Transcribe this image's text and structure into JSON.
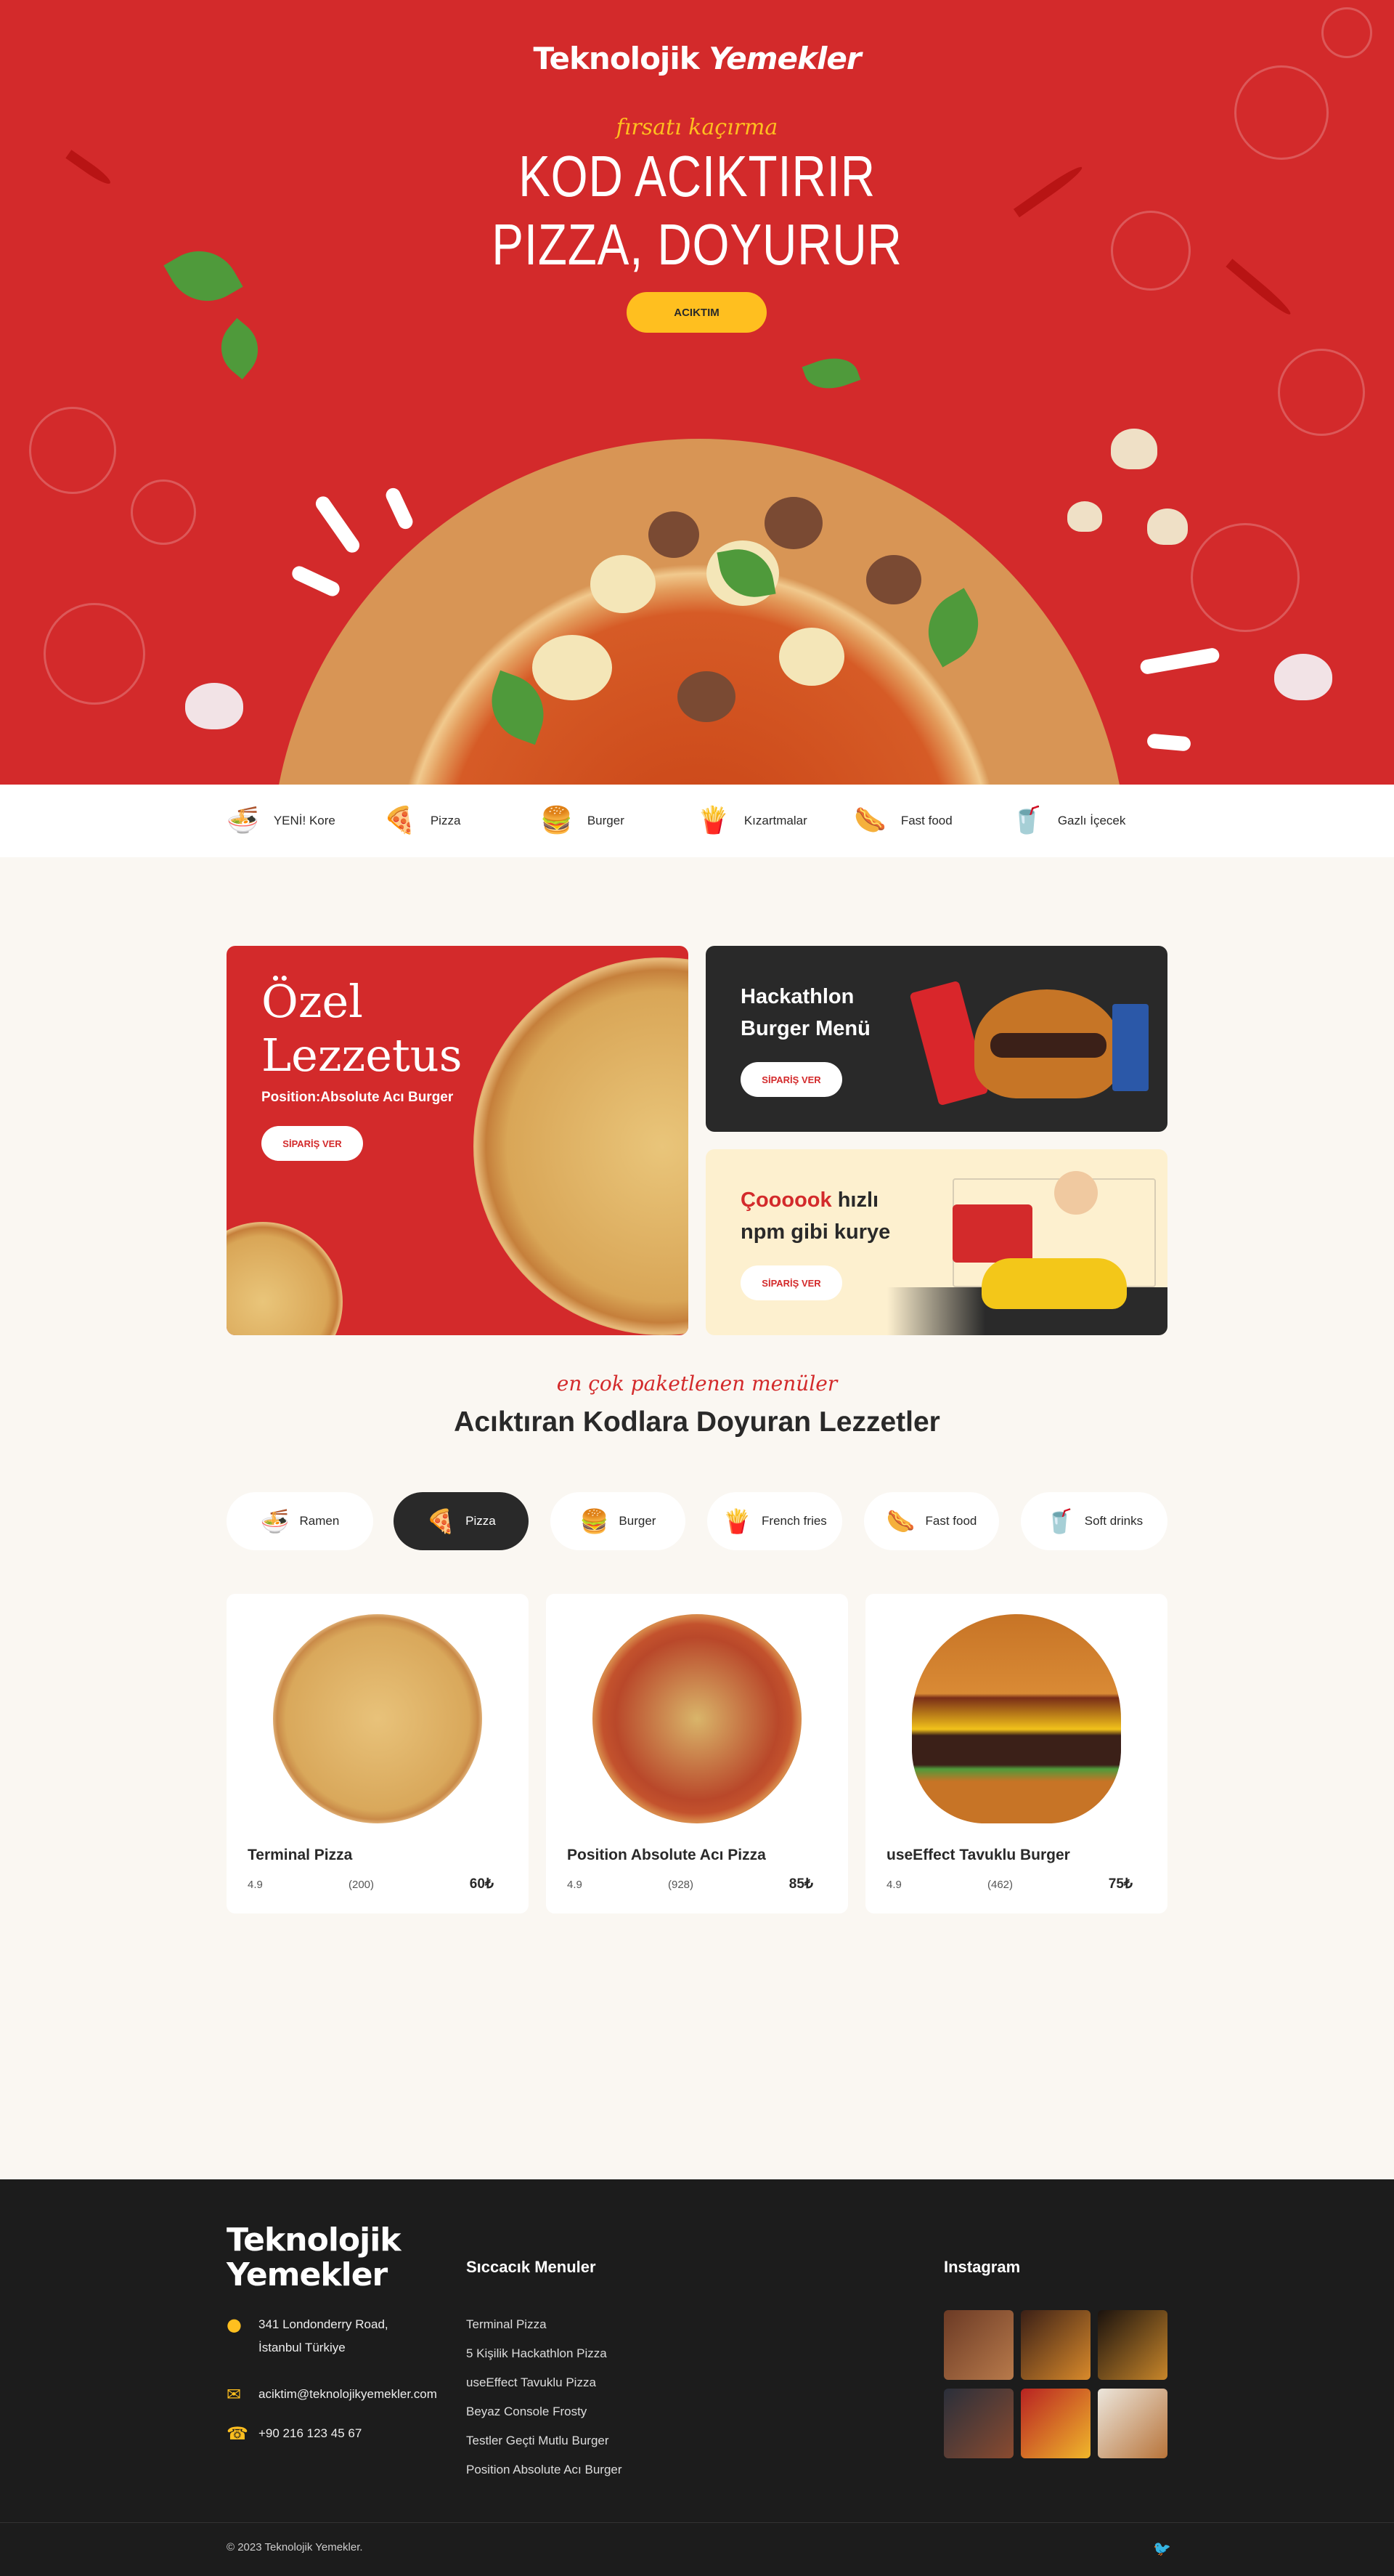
{
  "brand": {
    "part1": "Teknolojik",
    "part2": "Yemekler"
  },
  "hero": {
    "script": "fırsatı kaçırma",
    "title_line1": "KOD ACIKTIRIR",
    "title_line2": "PIZZA, DOYURUR",
    "cta": "ACIKTIM"
  },
  "categories": [
    {
      "label": "YENİ! Kore",
      "icon": "ramen-icon",
      "glyph": "🍜"
    },
    {
      "label": "Pizza",
      "icon": "pizza-icon",
      "glyph": "🍕"
    },
    {
      "label": "Burger",
      "icon": "burger-icon",
      "glyph": "🍔"
    },
    {
      "label": "Kızartmalar",
      "icon": "fries-icon",
      "glyph": "🍟"
    },
    {
      "label": "Fast food",
      "icon": "fastfood-icon",
      "glyph": "🌭"
    },
    {
      "label": "Gazlı İçecek",
      "icon": "drink-icon",
      "glyph": "🥤"
    }
  ],
  "promos": {
    "big": {
      "title_line1": "Özel",
      "title_line2": "Lezzetus",
      "subtitle": "Position:Absolute Acı Burger",
      "cta": "SİPARİŞ VER"
    },
    "dark": {
      "title_line1": "Hackathlon",
      "title_line2": "Burger Menü",
      "cta": "SİPARİŞ VER"
    },
    "cream": {
      "accent": "Çoooook",
      "title_rest": " hızlı",
      "title_line2": "npm gibi kurye",
      "cta": "SİPARİŞ VER"
    }
  },
  "menu": {
    "script": "en çok paketlenen menüler",
    "title": "Acıktıran Kodlara Doyuran Lezzetler",
    "tabs": [
      {
        "label": "Ramen",
        "icon": "ramen-icon",
        "glyph": "🍜",
        "active": false
      },
      {
        "label": "Pizza",
        "icon": "pizza-icon",
        "glyph": "🍕",
        "active": true
      },
      {
        "label": "Burger",
        "icon": "burger-icon",
        "glyph": "🍔",
        "active": false
      },
      {
        "label": "French fries",
        "icon": "fries-icon",
        "glyph": "🍟",
        "active": false
      },
      {
        "label": "Fast food",
        "icon": "fastfood-icon",
        "glyph": "🌭",
        "active": false
      },
      {
        "label": "Soft drinks",
        "icon": "drink-icon",
        "glyph": "🥤",
        "active": false
      }
    ],
    "products": [
      {
        "name": "Terminal Pizza",
        "rating": "4.9",
        "reviews": "(200)",
        "price": "60₺"
      },
      {
        "name": "Position Absolute Acı Pizza",
        "rating": "4.9",
        "reviews": "(928)",
        "price": "85₺"
      },
      {
        "name": "useEffect Tavuklu Burger",
        "rating": "4.9",
        "reviews": "(462)",
        "price": "75₺"
      }
    ]
  },
  "footer": {
    "logo_line1": "Teknolojik",
    "logo_line2": "Yemekler",
    "address_line1": "341 Londonderry Road,",
    "address_line2": "İstanbul Türkiye",
    "email": "aciktim@teknolojikyemekler.com",
    "phone": "+90 216 123 45 67",
    "menus_heading": "Sıccacık Menuler",
    "menu_links": [
      "Terminal Pizza",
      "5 Kişilik Hackathlon Pizza",
      "useEffect Tavuklu Pizza",
      "Beyaz  Console Frosty",
      "Testler Geçti Mutlu Burger",
      "Position Absolute Acı Burger"
    ],
    "instagram_heading": "Instagram",
    "copyright": "© 2023 Teknolojik Yemekler."
  },
  "colors": {
    "brand_red": "#d32a2b",
    "accent_yellow": "#ffbf1f",
    "dark": "#292929",
    "cream": "#faf7f2"
  }
}
